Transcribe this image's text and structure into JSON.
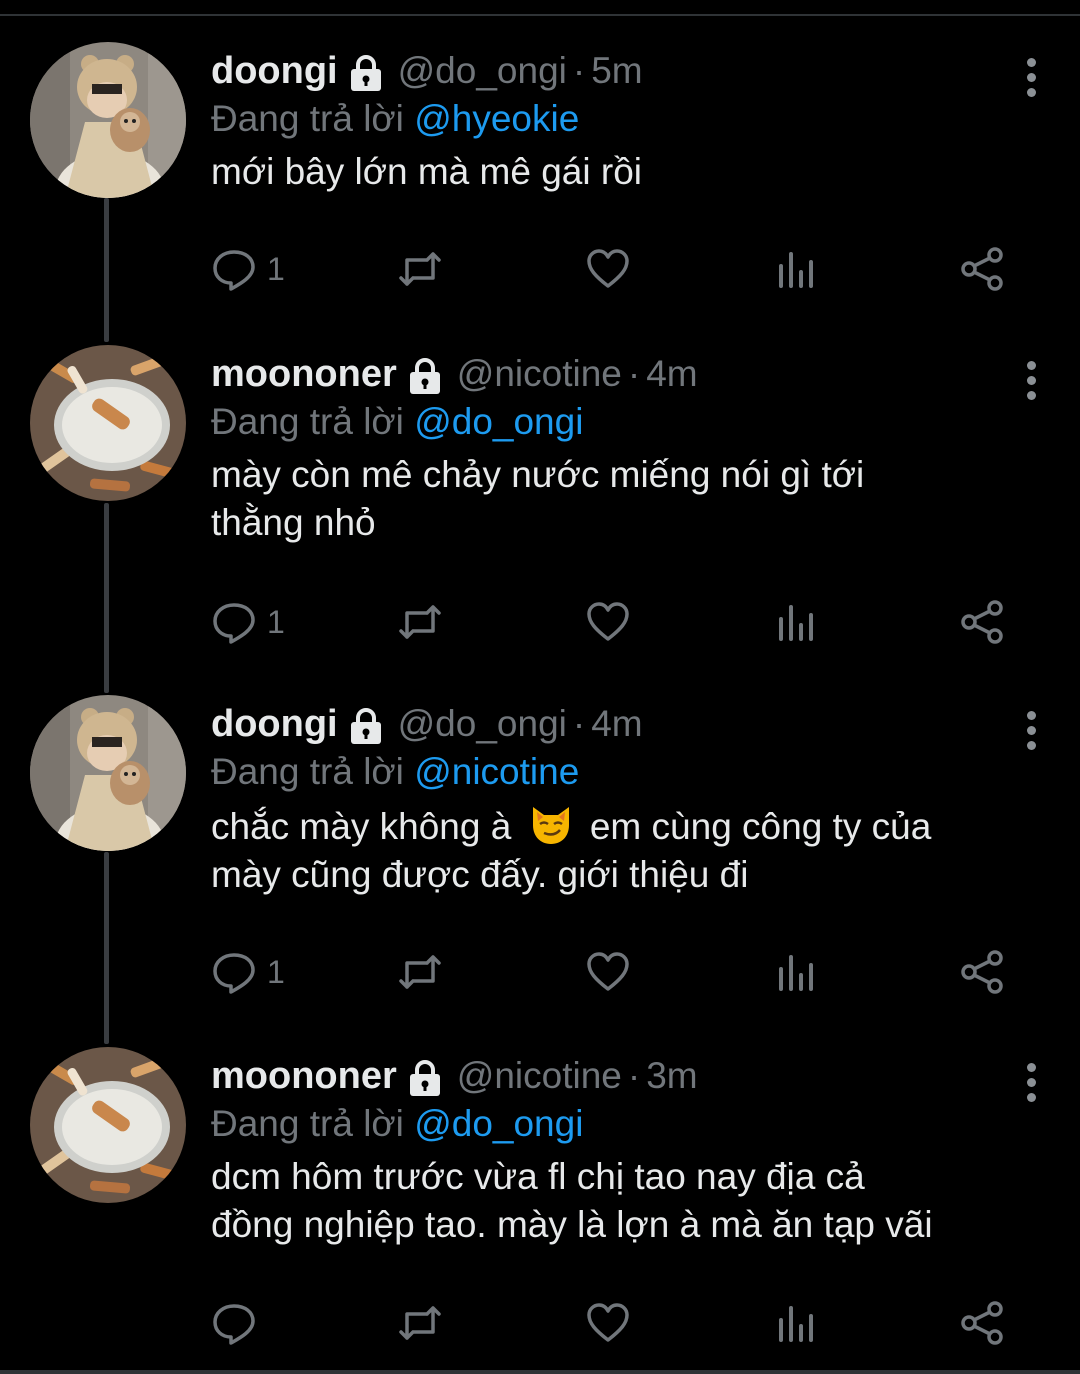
{
  "tweets": [
    {
      "name": "doongi",
      "handle": "@do_ongi",
      "separator": "·",
      "time": "5m",
      "replying_prefix": "Đang trả lời",
      "replying_to": "@hyeokie",
      "text_lines": [
        "mới bây lớn mà mê gái rồi"
      ],
      "reply_count": "1",
      "avatar": "person-with-bear-hat-holding-dog"
    },
    {
      "name": "moononer",
      "handle": "@nicotine",
      "separator": "·",
      "time": "4m",
      "replying_prefix": "Đang trả lời",
      "replying_to": "@do_ongi",
      "text_lines": [
        "mày còn mê chảy nước miếng nói gì tới",
        "thằng nhỏ"
      ],
      "reply_count": "1",
      "avatar": "cigarette-butts-in-bowl"
    },
    {
      "name": "doongi",
      "handle": "@do_ongi",
      "separator": "·",
      "time": "4m",
      "replying_prefix": "Đang trả lời",
      "replying_to": "@nicotine",
      "text_line1_before_emoji": "chắc mày không à",
      "emoji": "smirking-cat-emoji",
      "text_line1_after_emoji": "em cùng công ty của",
      "text_line2": "mày cũng được đấy. giới thiệu đi",
      "reply_count": "1",
      "avatar": "person-with-bear-hat-holding-dog"
    },
    {
      "name": "moononer",
      "handle": "@nicotine",
      "separator": "·",
      "time": "3m",
      "replying_prefix": "Đang trả lời",
      "replying_to": "@do_ongi",
      "text_lines": [
        "dcm hôm trước vừa fl chị tao nay địa cả",
        "đồng nghiệp tao. mày là lợn à mà ăn tạp vãi"
      ],
      "reply_count": "",
      "avatar": "cigarette-butts-in-bowl"
    }
  ],
  "icons": {
    "lock": "lock-icon",
    "reply": "reply-icon",
    "retweet": "retweet-icon",
    "like": "heart-icon",
    "views": "analytics-icon",
    "share": "share-icon",
    "more": "more-vertical-icon"
  },
  "colors": {
    "background": "#000000",
    "text": "#e7e9ea",
    "muted": "#71767b",
    "mention": "#1d9bf0",
    "thread_line": "#3a3d41"
  }
}
